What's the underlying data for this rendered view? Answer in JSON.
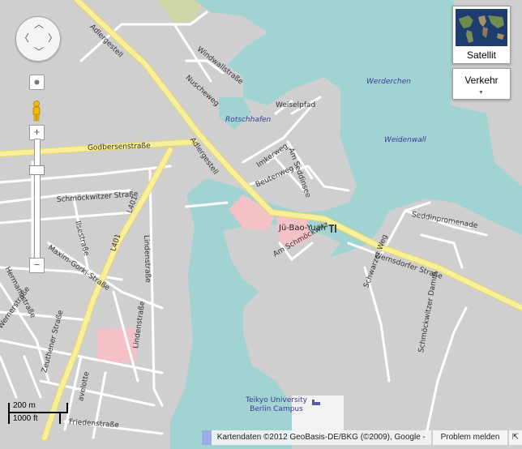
{
  "map": {
    "labels": {
      "adlergestell_1": "Adlergestell",
      "adlergestell_2": "Adlergestell",
      "windwallstrasse": "Windwallstraße",
      "nuscheweg": "Nuscheweg",
      "rotschhafen": "Rotschhafen",
      "weiselpfad": "Weiselpfad",
      "werderchen": "Werderchen",
      "weidenwall": "Weidenwall",
      "godbersenstrasse": "Godbersenstraße",
      "imkerweg": "Imkerweg",
      "am_seddinsee": "Am Seddinsee",
      "beutenweg": "Beutenweg",
      "schmockwitzer_strasse": "Schmöckwitzer Straße",
      "l401_a": "L401",
      "l401_b": "L401",
      "lindenstrasse_1": "Lindenstraße",
      "lindenstrasse_2": "Lindenstraße",
      "ilsestrasse": "Ilsestraße",
      "maxim_gorki": "Maxim-Gorki-Straße",
      "hermannstrasse": "Hermannstraße",
      "wernerstrasse": "Wernerstraße",
      "zeuthener_strasse": "Zeuthener Straße",
      "friedenstrasse": "Friedenstraße",
      "am_schmockwitz": "Am Schmöckwitz",
      "ju_bao_yuan": "Jü-Bao-Yuan",
      "wernsdorfer_strasse": "Wernsdorfer Straße",
      "seddinpromenade": "Seddinpromenade",
      "schwarzer_weg": "Schwarzer Weg",
      "schmockwitzer_damm": "Schmöckwitzer Damm",
      "campus_line1": "Teikyo University",
      "campus_line2": "Berlin Campus",
      "gravelotte": "avelotte"
    }
  },
  "controls": {
    "satellite_label": "Satellit",
    "traffic_label": "Verkehr",
    "zoom_in": "+",
    "zoom_out": "−"
  },
  "scale": {
    "metric": "200 m",
    "imperial": "1000 ft"
  },
  "footer": {
    "attribution": "Kartendaten ©2012 GeoBasis-DE/BKG (©2009), Google -",
    "report": "Problem melden"
  },
  "colors": {
    "land": "#cfcfcf",
    "water": "#a1d3d3",
    "major_road": "#f7ef9a",
    "minor_road": "#ffffff",
    "highlight_area": "#f4c2c6"
  }
}
